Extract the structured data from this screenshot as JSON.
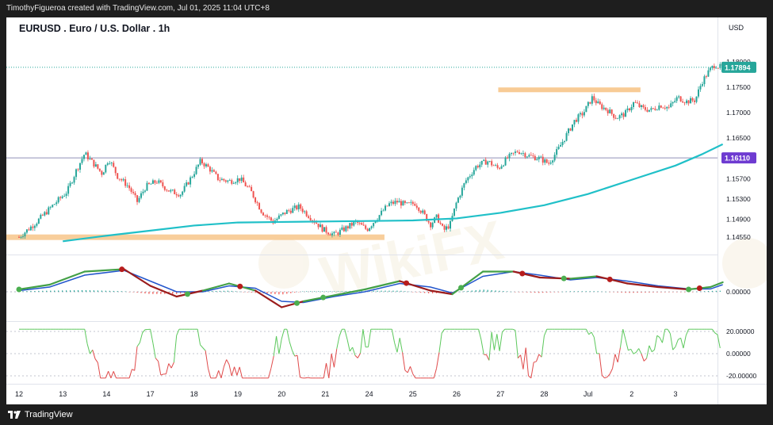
{
  "header": {
    "attribution": "TimothyFigueroa created with TradingView.com, Jul 01, 2025 11:04 UTC+8"
  },
  "footer": {
    "brand": "TradingView"
  },
  "watermark": {
    "text": "WikiFX"
  },
  "colors": {
    "candle_up": "#26a69a",
    "candle_down": "#ef5350",
    "ma_line": "#20c0c8",
    "support_band": "#f7c58a",
    "resistance_band": "#f7c58a",
    "trendline": "#f0a020",
    "level_line": "#9090b8",
    "price_badge": "#26a69a",
    "level_badge": "#6e3bd1",
    "macd_line": "#2e7d32",
    "signal_line": "#2255cc",
    "signal_dot_up": "#4caf50",
    "signal_dot_down": "#b71c1c"
  },
  "chart_data": {
    "type": "candlestick",
    "title": "EURUSD . Euro / U.S. Dollar . 1h",
    "currency_label": "USD",
    "price_axis_ticks": [
      "1.18000",
      "1.17500",
      "1.17000",
      "1.16500",
      "1.16110",
      "1.15700",
      "1.15300",
      "1.14900",
      "1.14550"
    ],
    "ylim": [
      1.1435,
      1.1825
    ],
    "current_price": {
      "label": "1.17894",
      "value": 1.17894
    },
    "horizontal_level": {
      "label": "1.16110",
      "value": 1.1611
    },
    "support_band": {
      "value": 1.1455,
      "from_day": "12",
      "to_day": "23"
    },
    "resistance_band": {
      "value": 1.1745,
      "from_day": "26",
      "to_day": "Jul"
    },
    "rising_trendline": {
      "from": [
        27.1,
        1.1683
      ],
      "to": [
        28.95,
        1.172
      ]
    },
    "x_tick_labels": [
      "12",
      "13",
      "14",
      "17",
      "18",
      "19",
      "20",
      "21",
      "24",
      "25",
      "26",
      "27",
      "28",
      "Jul",
      "2",
      "3"
    ],
    "price_path": [
      [
        0.0,
        1.1455
      ],
      [
        0.4,
        1.1485
      ],
      [
        0.8,
        1.152
      ],
      [
        1.1,
        1.1545
      ],
      [
        1.3,
        1.1585
      ],
      [
        1.5,
        1.162
      ],
      [
        1.7,
        1.16
      ],
      [
        1.9,
        1.158
      ],
      [
        2.05,
        1.161
      ],
      [
        2.25,
        1.1575
      ],
      [
        2.5,
        1.1555
      ],
      [
        2.7,
        1.1525
      ],
      [
        2.9,
        1.1555
      ],
      [
        3.15,
        1.1565
      ],
      [
        3.45,
        1.1545
      ],
      [
        3.7,
        1.154
      ],
      [
        3.95,
        1.1575
      ],
      [
        4.15,
        1.1605
      ],
      [
        4.35,
        1.159
      ],
      [
        4.55,
        1.157
      ],
      [
        4.8,
        1.1565
      ],
      [
        5.05,
        1.157
      ],
      [
        5.3,
        1.1545
      ],
      [
        5.55,
        1.1505
      ],
      [
        5.8,
        1.1485
      ],
      [
        6.1,
        1.1505
      ],
      [
        6.4,
        1.1515
      ],
      [
        6.65,
        1.1495
      ],
      [
        6.95,
        1.147
      ],
      [
        7.2,
        1.146
      ],
      [
        7.45,
        1.1472
      ],
      [
        7.7,
        1.1485
      ],
      [
        7.95,
        1.147
      ],
      [
        8.2,
        1.1495
      ],
      [
        8.45,
        1.152
      ],
      [
        8.65,
        1.1525
      ],
      [
        8.85,
        1.1518
      ],
      [
        9.05,
        1.1522
      ],
      [
        9.25,
        1.15
      ],
      [
        9.4,
        1.148
      ],
      [
        9.55,
        1.1495
      ],
      [
        9.7,
        1.1468
      ],
      [
        9.85,
        1.148
      ],
      [
        10.0,
        1.1525
      ],
      [
        10.2,
        1.1565
      ],
      [
        10.45,
        1.1595
      ],
      [
        10.7,
        1.1605
      ],
      [
        10.95,
        1.159
      ],
      [
        11.15,
        1.161
      ],
      [
        11.4,
        1.1625
      ],
      [
        11.65,
        1.1615
      ],
      [
        11.9,
        1.161
      ],
      [
        12.1,
        1.16
      ],
      [
        12.3,
        1.1625
      ],
      [
        12.5,
        1.1655
      ],
      [
        12.7,
        1.1685
      ],
      [
        12.9,
        1.17
      ],
      [
        13.1,
        1.173
      ],
      [
        13.25,
        1.1715
      ],
      [
        13.45,
        1.1705
      ],
      [
        13.65,
        1.169
      ],
      [
        13.85,
        1.1698
      ],
      [
        14.05,
        1.172
      ],
      [
        14.25,
        1.1708
      ],
      [
        14.45,
        1.1705
      ],
      [
        14.65,
        1.1715
      ],
      [
        14.85,
        1.171
      ],
      [
        15.05,
        1.173
      ],
      [
        15.25,
        1.1722
      ],
      [
        15.45,
        1.1725
      ],
      [
        15.6,
        1.176
      ],
      [
        15.75,
        1.178
      ],
      [
        15.9,
        1.1795
      ],
      [
        16.0,
        1.179
      ],
      [
        16.08,
        1.17894
      ]
    ],
    "ma_path": [
      [
        1.0,
        1.1447
      ],
      [
        2.0,
        1.1458
      ],
      [
        3.0,
        1.1468
      ],
      [
        4.0,
        1.1478
      ],
      [
        5.0,
        1.1484
      ],
      [
        6.0,
        1.1485
      ],
      [
        7.0,
        1.1486
      ],
      [
        8.0,
        1.1487
      ],
      [
        9.0,
        1.1488
      ],
      [
        10.0,
        1.1492
      ],
      [
        11.0,
        1.1503
      ],
      [
        12.0,
        1.1518
      ],
      [
        13.0,
        1.154
      ],
      [
        14.0,
        1.1568
      ],
      [
        15.0,
        1.1596
      ],
      [
        15.6,
        1.1618
      ],
      [
        16.08,
        1.1638
      ]
    ],
    "macd_panel": {
      "zero_label": "0.00000",
      "macd_line": [
        [
          0.0,
          0.1
        ],
        [
          0.7,
          0.3
        ],
        [
          1.5,
          0.85
        ],
        [
          2.4,
          0.95
        ],
        [
          3.0,
          0.25
        ],
        [
          3.6,
          -0.2
        ],
        [
          4.2,
          0.05
        ],
        [
          4.8,
          0.35
        ],
        [
          5.4,
          0.05
        ],
        [
          6.0,
          -0.65
        ],
        [
          6.5,
          -0.4
        ],
        [
          7.2,
          -0.15
        ],
        [
          7.9,
          0.1
        ],
        [
          8.7,
          0.45
        ],
        [
          9.4,
          0.05
        ],
        [
          9.9,
          -0.1
        ],
        [
          10.6,
          0.85
        ],
        [
          11.3,
          0.85
        ],
        [
          11.9,
          0.6
        ],
        [
          12.6,
          0.55
        ],
        [
          13.2,
          0.65
        ],
        [
          13.9,
          0.35
        ],
        [
          14.6,
          0.2
        ],
        [
          15.3,
          0.1
        ],
        [
          15.8,
          0.2
        ],
        [
          16.08,
          0.4
        ]
      ],
      "signal_line": [
        [
          0.0,
          0.05
        ],
        [
          0.7,
          0.2
        ],
        [
          1.5,
          0.7
        ],
        [
          2.4,
          0.9
        ],
        [
          3.0,
          0.45
        ],
        [
          3.6,
          0.0
        ],
        [
          4.2,
          0.0
        ],
        [
          4.8,
          0.25
        ],
        [
          5.4,
          0.15
        ],
        [
          6.0,
          -0.4
        ],
        [
          6.5,
          -0.45
        ],
        [
          7.2,
          -0.2
        ],
        [
          7.9,
          0.0
        ],
        [
          8.7,
          0.35
        ],
        [
          9.4,
          0.2
        ],
        [
          9.9,
          -0.05
        ],
        [
          10.6,
          0.65
        ],
        [
          11.3,
          0.85
        ],
        [
          11.9,
          0.7
        ],
        [
          12.6,
          0.5
        ],
        [
          13.2,
          0.6
        ],
        [
          13.9,
          0.45
        ],
        [
          14.6,
          0.25
        ],
        [
          15.3,
          0.12
        ],
        [
          15.8,
          0.12
        ],
        [
          16.08,
          0.3
        ]
      ],
      "cross_signals": [
        {
          "x": 0.0,
          "dir": "up"
        },
        {
          "x": 2.35,
          "dir": "down"
        },
        {
          "x": 3.85,
          "dir": "up"
        },
        {
          "x": 5.05,
          "dir": "down"
        },
        {
          "x": 6.35,
          "dir": "up"
        },
        {
          "x": 6.95,
          "dir": "up"
        },
        {
          "x": 8.85,
          "dir": "down"
        },
        {
          "x": 10.1,
          "dir": "up"
        },
        {
          "x": 11.5,
          "dir": "down"
        },
        {
          "x": 12.45,
          "dir": "up"
        },
        {
          "x": 13.5,
          "dir": "down"
        },
        {
          "x": 15.3,
          "dir": "up"
        },
        {
          "x": 15.55,
          "dir": "down"
        }
      ]
    },
    "oscillator_panel": {
      "tick_labels": [
        "20.00000",
        "0.00000",
        "-20.00000"
      ],
      "ylim": [
        -25,
        25
      ]
    }
  }
}
